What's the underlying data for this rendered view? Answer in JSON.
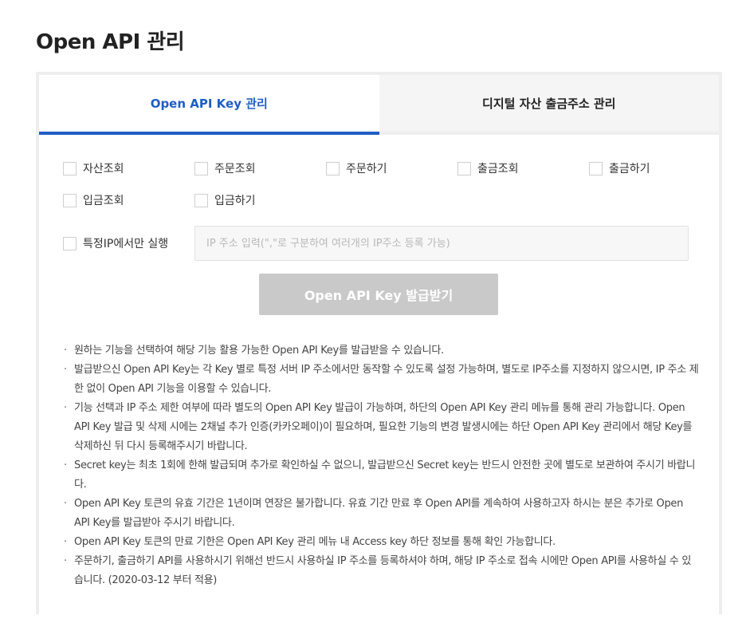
{
  "page": {
    "title": "Open API 관리"
  },
  "tabs": [
    {
      "label": "Open API Key 관리",
      "active": true
    },
    {
      "label": "디지털 자산 출금주소 관리",
      "active": false
    }
  ],
  "permissions": {
    "row1": [
      "자산조회",
      "주문조회",
      "주문하기",
      "출금조회",
      "출금하기"
    ],
    "row2": [
      "입금조회",
      "입금하기"
    ]
  },
  "ip_restriction": {
    "label": "특정IP에서만 실행",
    "placeholder": "IP 주소 입력(\",\"로 구분하여 여러개의 IP주소 등록 가능)"
  },
  "issue_button": {
    "label": "Open API Key 발급받기"
  },
  "notes": [
    "원하는 기능을 선택하여 해당 기능 활용 가능한 Open API Key를 발급받을 수 있습니다.",
    "발급받으신 Open API Key는 각 Key 별로 특정 서버 IP 주소에서만 동작할 수 있도록 설정 가능하며, 별도로 IP주소를 지정하지 않으시면, IP 주소 제한 없이 Open API 기능을 이용할 수 있습니다.",
    "기능 선택과 IP 주소 제한 여부에 따라 별도의 Open API Key 발급이 가능하며, 하단의 Open API Key 관리 메뉴를 통해 관리 가능합니다. Open API Key 발급 및 삭제 시에는 2채널 추가 인증(카카오페이)이 필요하며, 필요한 기능의 변경 발생시에는 하단 Open API Key 관리에서 해당 Key를 삭제하신 뒤 다시 등록해주시기 바랍니다.",
    "Secret key는 최초 1회에 한해 발급되며 추가로 확인하실 수 없으니, 발급받으신 Secret key는 반드시 안전한 곳에 별도로 보관하여 주시기 바랍니다.",
    "Open API Key 토큰의 유효 기간은 1년이며 연장은 불가합니다. 유효 기간 만료 후 Open API를 계속하여 사용하고자 하시는 분은 추가로 Open API Key를 발급받아 주시기 바랍니다.",
    "Open API Key 토큰의 만료 기한은 Open API Key 관리 메뉴 내 Access key 하단 정보를 통해 확인 가능합니다.",
    "주문하기, 출금하기 API를 사용하시기 위해선 반드시 사용하실 IP 주소를 등록하셔야 하며, 해당 IP 주소로 접속 시에만 Open API를 사용하실 수 있습니다. (2020-03-12 부터 적용)"
  ],
  "colors": {
    "accent": "#1f5ec4",
    "button_disabled": "#c9c9c9",
    "border": "#eeeeee"
  }
}
